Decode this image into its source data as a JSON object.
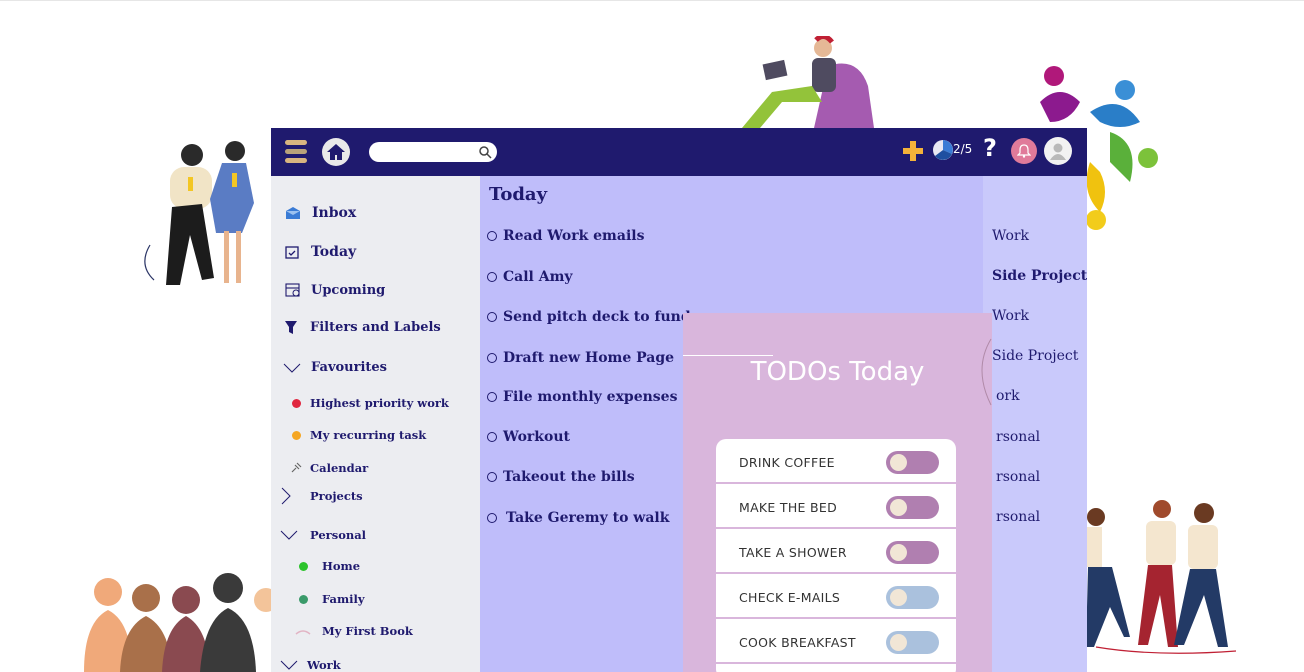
{
  "header": {
    "search_placeholder": "",
    "progress": "2/5",
    "help": "?"
  },
  "sidebar": {
    "items": [
      {
        "label": "Inbox",
        "icon": "inbox-icon"
      },
      {
        "label": "Today",
        "icon": "calendar-today-icon"
      },
      {
        "label": "Upcoming",
        "icon": "calendar-upcoming-icon"
      },
      {
        "label": "Filters and Labels",
        "icon": "filter-icon"
      },
      {
        "label": "Favourites",
        "icon": "chevron-down-icon"
      },
      {
        "label": "Highest priority work",
        "icon": "dot-icon",
        "color": "#e0263f"
      },
      {
        "label": "My recurring task",
        "icon": "dot-icon",
        "color": "#f5a623"
      },
      {
        "label": "Calendar",
        "icon": "pin-icon"
      },
      {
        "label": "Projects",
        "icon": "chevron-right-icon"
      },
      {
        "label": "Personal",
        "icon": "chevron-down-icon"
      },
      {
        "label": "Home",
        "icon": "dot-icon",
        "color": "#2cc32c"
      },
      {
        "label": "Family",
        "icon": "dot-icon",
        "color": "#3a9a6a"
      },
      {
        "label": "My First Book",
        "icon": "book-icon"
      },
      {
        "label": "Work",
        "icon": "chevron-down-icon"
      }
    ]
  },
  "main": {
    "title": "Today",
    "tasks": [
      "Read Work emails",
      "Call Amy",
      "Send pitch deck to fund ra",
      "Draft new Home Page",
      "File monthly expenses",
      "Workout",
      "Takeout the bills",
      "Take Geremy to walk"
    ]
  },
  "projects": [
    "Work",
    "Side Project",
    "Work",
    "Side Project",
    "ork",
    "rsonal",
    "rsonal",
    "rsonal"
  ],
  "overlay": {
    "title": "TODOs Today",
    "items": [
      {
        "label": "DRINK COFFEE",
        "color": "#b07fb0"
      },
      {
        "label": "MAKE THE BED",
        "color": "#b07fb0"
      },
      {
        "label": "TAKE A SHOWER",
        "color": "#b07fb0"
      },
      {
        "label": "CHECK E-MAILS",
        "color": "#aac1dd"
      },
      {
        "label": "COOK BREAKFAST",
        "color": "#aac1dd"
      }
    ]
  },
  "colors": {
    "navbar": "#1f1a6e",
    "sidebar": "#ecedf1",
    "main": "#bfbdfa",
    "overlay": "#d9b6dc"
  }
}
